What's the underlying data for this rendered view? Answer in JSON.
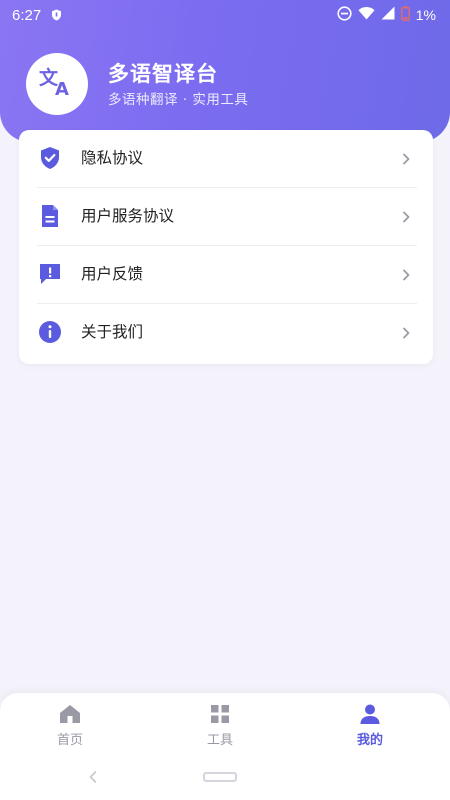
{
  "status_bar": {
    "time": "6:27",
    "battery": "1%"
  },
  "app": {
    "title": "多语智译台",
    "subtitle": "多语种翻译 · 实用工具",
    "logo_icon": "translate-icon"
  },
  "menu": {
    "items": [
      {
        "label": "隐私协议",
        "icon": "shield-check-icon"
      },
      {
        "label": "用户服务协议",
        "icon": "document-icon"
      },
      {
        "label": "用户反馈",
        "icon": "feedback-icon"
      },
      {
        "label": "关于我们",
        "icon": "info-icon"
      }
    ]
  },
  "bottom_nav": {
    "items": [
      {
        "label": "首页",
        "icon": "home-icon",
        "active": false
      },
      {
        "label": "工具",
        "icon": "grid-icon",
        "active": false
      },
      {
        "label": "我的",
        "icon": "person-icon",
        "active": true
      }
    ]
  },
  "colors": {
    "accent": "#5b5be0",
    "header_gradient_start": "#8a76f3",
    "header_gradient_end": "#6e6ae8",
    "inactive": "#9a9aa6"
  }
}
